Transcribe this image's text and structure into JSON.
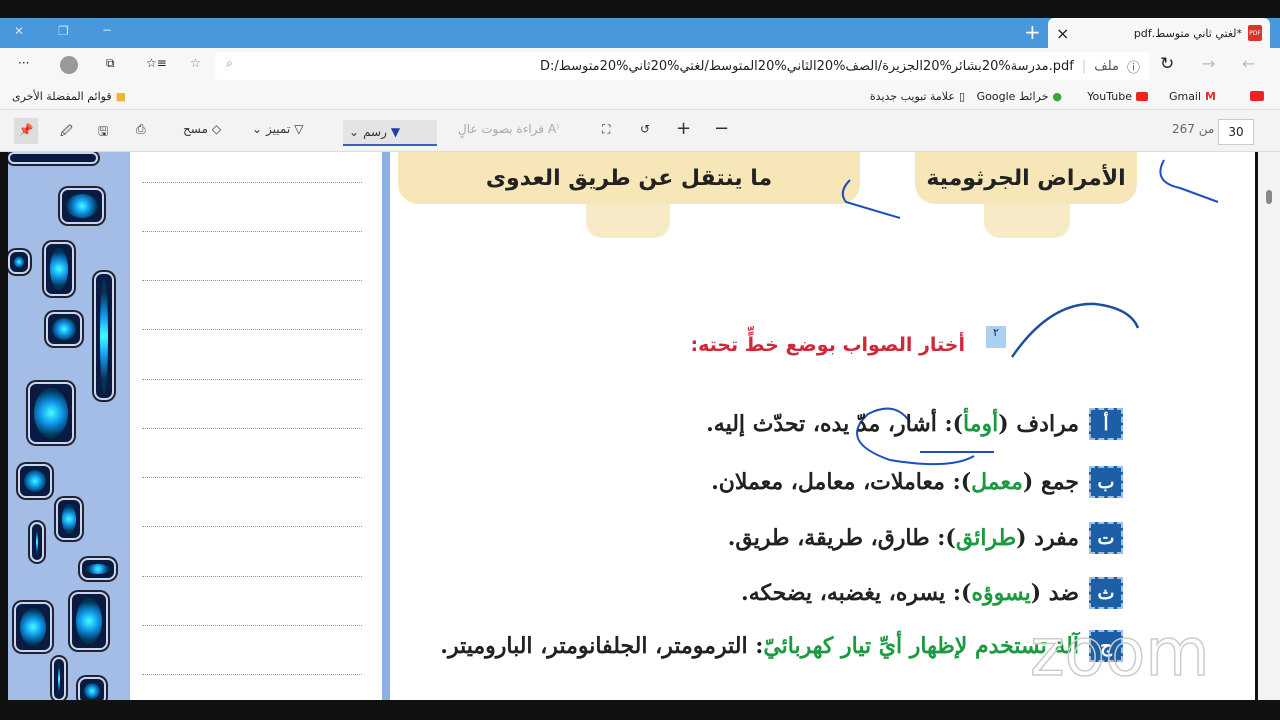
{
  "tab": {
    "title": "*لغتي ثاني متوسط.pdf",
    "close": "×",
    "new_tab": "+"
  },
  "window": {
    "minimize": "−",
    "restore": "❐",
    "close": "✕"
  },
  "address": {
    "label": "ملف",
    "url": "D:/مدرسة%20بشائر%20الجزيرة/الصف%20الثاني%20المتوسط/لغتي%20ثاني%20متوسط.pdf"
  },
  "bookmarks": {
    "items": [
      "Gmail",
      "YouTube",
      "خرائط Google",
      "علامة تبويب جديدة"
    ],
    "other": "قوائم المفضلة الأخرى"
  },
  "pdf_toolbar": {
    "page": "30",
    "of": "من 267",
    "read_aloud": "قراءة بصوت عالٍ",
    "draw": "رسم",
    "highlight": "تمييز",
    "erase": "مسح"
  },
  "page": {
    "pill_right": "الأمراض الجرثومية",
    "pill_left": "ما ينتقل عن طريق العدوى",
    "exercise_number": "٢",
    "instruction": "أختار الصواب بوضع خطٍّ تحته:",
    "items": [
      {
        "letter": "أ",
        "prefix": "مرادف (",
        "word": "أومأ",
        "suffix": "): أشار، مدّ يده، تحدّث إليه."
      },
      {
        "letter": "ب",
        "prefix": "جمع (",
        "word": "معمل",
        "suffix": "): معاملات، معامل، معملان."
      },
      {
        "letter": "ت",
        "prefix": "مفرد (",
        "word": "طرائق",
        "suffix": "): طارق، طريقة، طريق."
      },
      {
        "letter": "ث",
        "prefix": "ضد (",
        "word": "يسوؤه",
        "suffix": "): يسره، يغضبه، يضحكه."
      },
      {
        "letter": "ج",
        "prefix": "",
        "word": "آلة تستخدم لإظهار أيِّ تيار كهربائيّ",
        "suffix": ": الترمومتر، الجلفانومتر، الباروميتر."
      }
    ],
    "watermark": "zoom"
  },
  "colors": {
    "tabbar": "#4a98dc",
    "accent_red": "#d0283a",
    "green": "#1b9a3f",
    "ink": "#1d4fbf"
  }
}
